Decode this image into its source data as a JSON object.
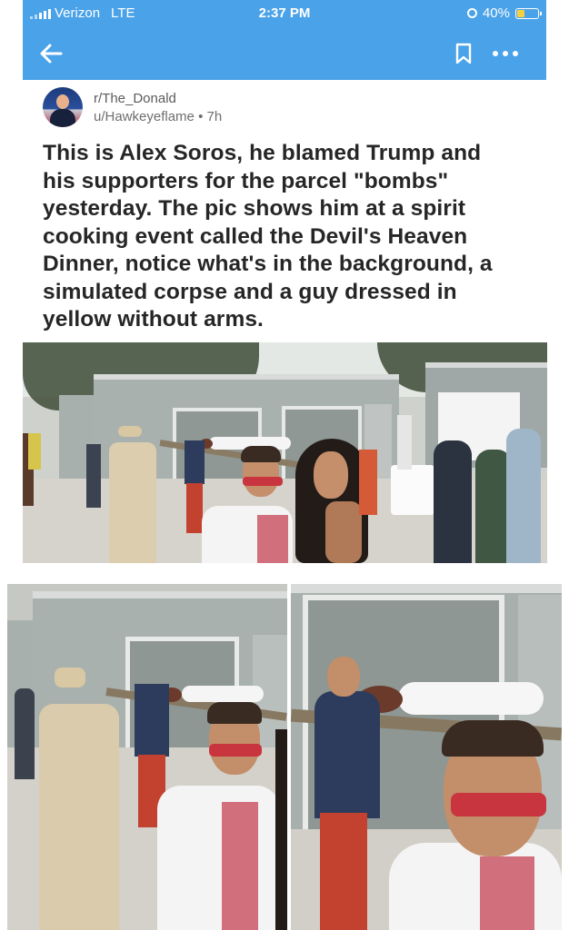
{
  "status_bar": {
    "carrier": "Verizon",
    "network": "LTE",
    "time": "2:37 PM",
    "battery": "40%",
    "battery_level": 0.4
  },
  "nav": {
    "back_icon": "arrow-left-icon",
    "bookmark_icon": "bookmark-icon",
    "more_icon": "more-dots-icon"
  },
  "post": {
    "subreddit": "r/The_Donald",
    "author": "u/Hawkeyeflame",
    "age": "7h",
    "separator": "•",
    "title": "This is Alex Soros, he blamed Trump and\nhis supporters for the parcel \"bombs\"\nyesterday. The pic shows him at a spirit\ncooking event called the Devil's Heaven\nDinner, notice what's in the background, a\nsimulated corpse and a guy dressed in\nyellow without arms."
  },
  "colors": {
    "accent": "#4aa2e8",
    "battery": "#f7d23e"
  }
}
